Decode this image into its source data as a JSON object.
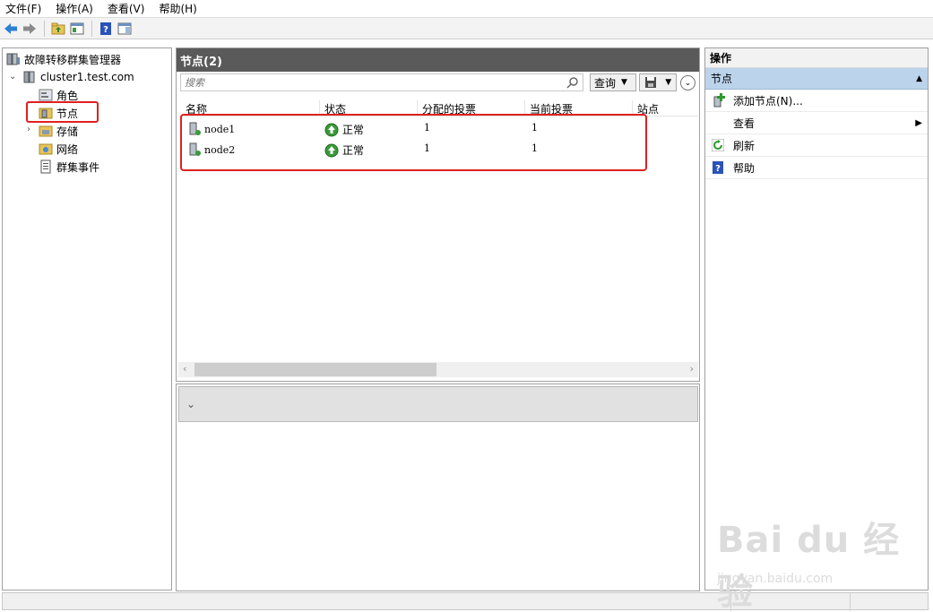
{
  "menu": [
    "文件(F)",
    "操作(A)",
    "查看(V)",
    "帮助(H)"
  ],
  "tree": {
    "root": "故障转移群集管理器",
    "cluster": "cluster1.test.com",
    "items": [
      "角色",
      "节点",
      "存储",
      "网络",
      "群集事件"
    ]
  },
  "center": {
    "title": "节点(2)",
    "search_placeholder": "搜索",
    "query_label": "查询",
    "columns": [
      "名称",
      "状态",
      "分配的投票",
      "当前投票",
      "站点"
    ],
    "rows": [
      {
        "name": "node1",
        "status": "正常",
        "assigned": "1",
        "current": "1"
      },
      {
        "name": "node2",
        "status": "正常",
        "assigned": "1",
        "current": "1"
      }
    ]
  },
  "actions": {
    "title": "操作",
    "section": "节点",
    "items": [
      "添加节点(N)...",
      "查看",
      "刷新",
      "帮助"
    ]
  },
  "watermark": {
    "main": "Bai du 经验",
    "sub": "jingyan.baidu.com"
  },
  "colors": {
    "highlight": "#e02020",
    "section_bg": "#bcd3ec",
    "title_bg": "#5a5a5a"
  }
}
